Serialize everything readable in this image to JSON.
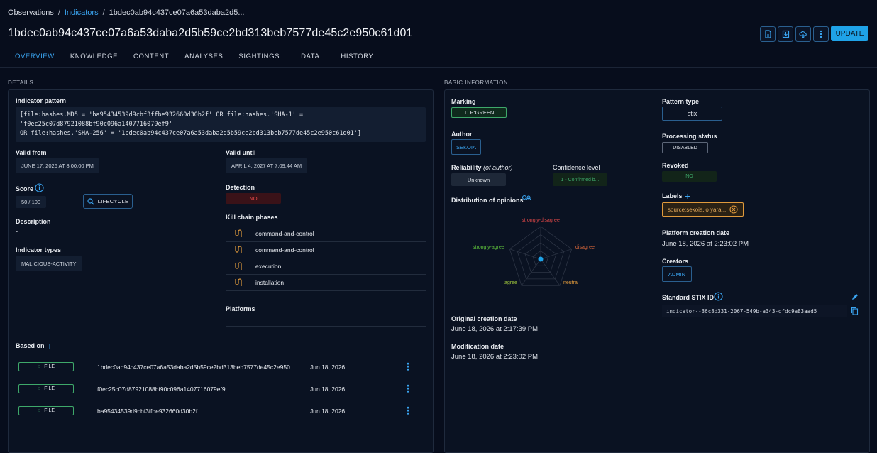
{
  "breadcrumb": {
    "root": "Observations",
    "section": "Indicators",
    "current": "1bdec0ab94c437ce07a6a53daba2d5..."
  },
  "page_title": "1bdec0ab94c437ce07a6a53daba2d5b59ce2bd313beb7577de45c2e950c61d01",
  "toolbar": {
    "update_label": "UPDATE"
  },
  "tabs": [
    "OVERVIEW",
    "KNOWLEDGE",
    "CONTENT",
    "ANALYSES",
    "SIGHTINGS",
    "DATA",
    "HISTORY"
  ],
  "details": {
    "section_label": "DETAILS",
    "pattern_label": "Indicator pattern",
    "pattern_line1": "[file:hashes.MD5 = 'ba95434539d9cbf3ffbe932660d30b2f' OR file:hashes.'SHA-1' = 'f0ec25c07d87921088bf90c096a1407716079ef9'",
    "pattern_line2": "OR file:hashes.'SHA-256' = '1bdec0ab94c437ce07a6a53daba2d5b59ce2bd313beb7577de45c2e950c61d01']",
    "valid_from_label": "Valid from",
    "valid_from": "JUNE 17, 2026 AT 8:00:00 PM",
    "valid_until_label": "Valid until",
    "valid_until": "APRIL 4, 2027 AT 7:09:44 AM",
    "score_label": "Score",
    "score": "50 / 100",
    "lifecycle_label": "LIFECYCLE",
    "detection_label": "Detection",
    "detection": "NO",
    "description_label": "Description",
    "description": "-",
    "kill_chain_label": "Kill chain phases",
    "kill_chain": [
      "command-and-control",
      "command-and-control",
      "execution",
      "installation"
    ],
    "indicator_types_label": "Indicator types",
    "indicator_type": "MALICIOUS-ACTIVITY",
    "platforms_label": "Platforms",
    "based_on_label": "Based on",
    "based_on": [
      {
        "type": "FILE",
        "value": "1bdec0ab94c437ce07a6a53daba2d5b59ce2bd313beb7577de45c2e950...",
        "date": "Jun 18, 2026"
      },
      {
        "type": "FILE",
        "value": "f0ec25c07d87921088bf90c096a1407716079ef9",
        "date": "Jun 18, 2026"
      },
      {
        "type": "FILE",
        "value": "ba95434539d9cbf3ffbe932660d30b2f",
        "date": "Jun 18, 2026"
      }
    ]
  },
  "basic": {
    "section_label": "BASIC INFORMATION",
    "marking_label": "Marking",
    "marking": "TLP:GREEN",
    "author_label": "Author",
    "author": "SEKOIA",
    "reliability_label": "Reliability",
    "reliability_note": "(of author)",
    "reliability": "Unknown",
    "confidence_label": "Confidence level",
    "confidence": "1 - Confirmed b...",
    "opinions_label": "Distribution of opinions",
    "radar_labels": [
      "strongly-disagree",
      "disagree",
      "neutral",
      "agree",
      "strongly-agree"
    ],
    "original_creation_label": "Original creation date",
    "original_creation": "June 18, 2026 at 2:17:39 PM",
    "modification_label": "Modification date",
    "modification": "June 18, 2026 at 2:23:02 PM",
    "pattern_type_label": "Pattern type",
    "pattern_type": "stix",
    "processing_label": "Processing status",
    "processing": "DISABLED",
    "revoked_label": "Revoked",
    "revoked": "NO",
    "labels_label": "Labels",
    "label_chip": "source:sekoia.io yara...",
    "platform_creation_label": "Platform creation date",
    "platform_creation": "June 18, 2026 at 2:23:02 PM",
    "creators_label": "Creators",
    "creator": "ADMIN",
    "stix_label": "Standard STIX ID",
    "stix_id": "indicator--36c8d331-2067-549b-a343-dfdc9a83aad5"
  },
  "colors": {
    "accent": "#3aa4f0",
    "green": "#3ea86a",
    "red": "#e04848",
    "orange": "#e09a3c",
    "bg": "#070d1c"
  }
}
